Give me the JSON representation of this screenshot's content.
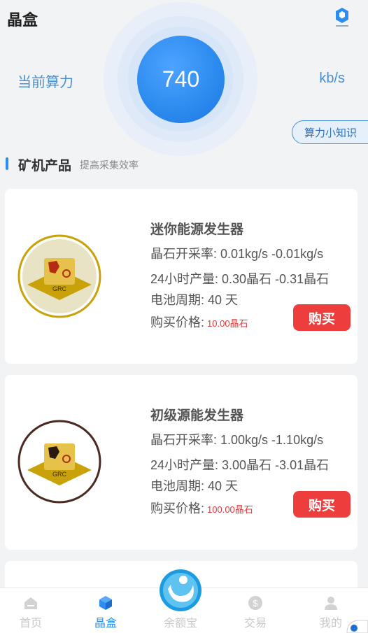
{
  "header": {
    "title": "晶盒",
    "logo_icon": "app-logo-icon"
  },
  "power": {
    "label": "当前算力",
    "value": "740",
    "unit": "kb/s",
    "tips_button": "算力小知识"
  },
  "section": {
    "title": "矿机产品",
    "subtitle": "提高采集效率"
  },
  "products": [
    {
      "name": "迷你能源发生器",
      "rate": "晶石开采率: 0.01kg/s -0.01kg/s",
      "output": "24小时产量: 0.30晶石 -0.31晶石",
      "battery": "电池周期: 40 天",
      "price_label": "购买价格:",
      "price_value": "10.00晶石",
      "buy_label": "购买",
      "badge_text": "GRC",
      "badge_color": "#c9a20a"
    },
    {
      "name": "初级源能发生器",
      "rate": "晶石开采率: 1.00kg/s -1.10kg/s",
      "output": "24小时产量: 3.00晶石 -3.01晶石",
      "battery": "电池周期: 40 天",
      "price_label": "购买价格:",
      "price_value": "100.00晶石",
      "buy_label": "购买",
      "badge_text": "GRC",
      "badge_color": "#4a2a22"
    }
  ],
  "tabbar": {
    "items": [
      {
        "label": "首页",
        "icon": "home-icon",
        "active": false
      },
      {
        "label": "晶盒",
        "icon": "cube-icon",
        "active": true
      },
      {
        "label": "余额宝",
        "icon": "wallet-logo-icon",
        "active": false
      },
      {
        "label": "交易",
        "icon": "dollar-icon",
        "active": false
      },
      {
        "label": "我的",
        "icon": "user-icon",
        "active": false
      }
    ]
  },
  "colors": {
    "accent": "#2d8cf0",
    "buy": "#ee3d3d",
    "price": "#e03a3a"
  }
}
